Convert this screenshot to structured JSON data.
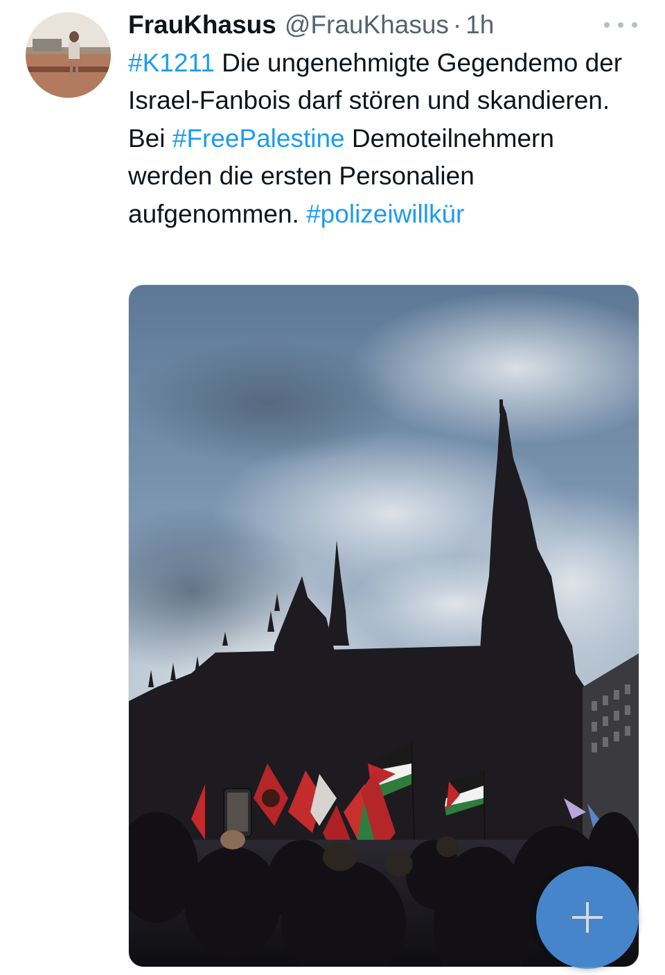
{
  "tweet": {
    "author": {
      "display_name": "FrauKhasus",
      "handle": "@FrauKhasus"
    },
    "separator": "·",
    "timestamp": "1h",
    "text_segments": [
      {
        "type": "hashtag",
        "text": "#K1211"
      },
      {
        "type": "text",
        "text": " Die ungenehmigte Gegendemo der Israel-Fanbois darf stören und skandieren. Bei "
      },
      {
        "type": "hashtag",
        "text": "#FreePalestine"
      },
      {
        "type": "text",
        "text": " Demoteilnehmern werden die ersten Personalien aufgenommen. "
      },
      {
        "type": "hashtag",
        "text": "#polizeiwillkür"
      }
    ],
    "media": {
      "kind": "photo",
      "subject": "cathedral-with-crowd-and-flags"
    }
  },
  "colors": {
    "hashtag": "#1d9bf0",
    "text": "#0f1419",
    "secondary": "#536471",
    "fab": "#4a8ed8"
  },
  "icons": {
    "more": "more-horizontal-icon",
    "compose": "plus-icon"
  }
}
